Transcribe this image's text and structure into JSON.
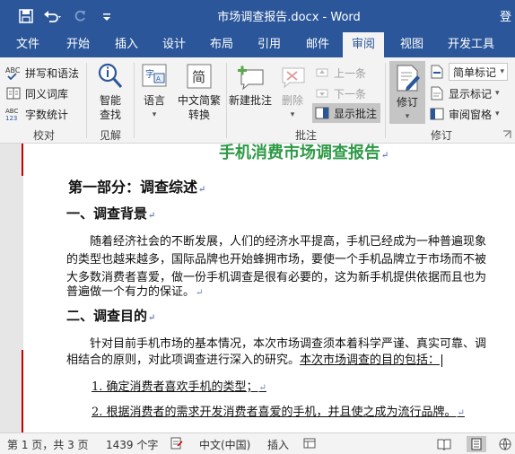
{
  "window": {
    "title": "市场调查报告.docx - Word",
    "title_right": "登"
  },
  "menu": {
    "tabs": [
      "文件",
      "开始",
      "插入",
      "设计",
      "布局",
      "引用",
      "邮件",
      "审阅",
      "视图",
      "开发工具"
    ],
    "active": "审阅"
  },
  "ribbon": {
    "proofing": {
      "spelling": "拼写和语法",
      "thesaurus": "同义词库",
      "word_count": "字数统计",
      "label": "校对"
    },
    "insights": {
      "smart_lookup_1": "智能",
      "smart_lookup_2": "查找",
      "label": "见解"
    },
    "language": {
      "label_text": "语言"
    },
    "chinese": {
      "line1": "中文简繁",
      "line2": "转换"
    },
    "comments": {
      "new_comment": "新建批注",
      "delete": "删除",
      "previous": "上一条",
      "next": "下一条",
      "show_comments": "显示批注",
      "label": "批注"
    },
    "tracking": {
      "track_changes": "修订",
      "markup_mode": "简单标记",
      "show_markup": "显示标记",
      "reviewing_pane": "审阅窗格",
      "label": "修订"
    }
  },
  "document": {
    "title": "手机消费市场调查报告",
    "part1": "第一部分：调查综述",
    "section1": "一、调查背景",
    "p1_line1": "随着经济社会的不断发展，人们的经济水平提高，手机已经成为一种普遍现象",
    "p1_line2": "的类型也越来越多，国际品牌也开始蜂拥市场，要使一个手机品牌立于市场而不被",
    "p1_line3": "大多数消费者喜爱，做一份手机调查是很有必要的，这为新手机提供依据而且也为",
    "p1_line4": "普遍做一个有力的保证。",
    "section2": "二、调查目的",
    "p2_line1": "针对目前手机市场的基本情况，本次市场调查须本着科学严谨、真实可靠、调",
    "p2_line2_a": "相结合的原则，对此项调查进行深入的研究。",
    "p2_line2_b": "本次市场调查的目的包括：",
    "item1": "1. 确定消费者喜欢手机的类型；",
    "item2": "2. 根据消费者的需求开发消费者喜爱的手机，并且使之成为流行品牌。"
  },
  "statusbar": {
    "page": "第 1 页，共 3 页",
    "words": "1439 个字",
    "language": "中文(中国)",
    "mode": "插入"
  }
}
